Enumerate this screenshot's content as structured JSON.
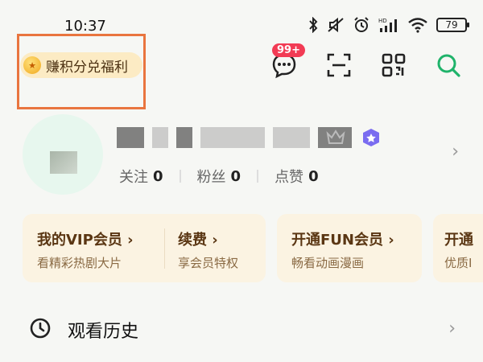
{
  "status_bar": {
    "time": "10:37",
    "battery": "79"
  },
  "earn": {
    "label": "赚积分兑福利"
  },
  "header_actions": {
    "message_badge": "99+"
  },
  "profile": {
    "stats": [
      {
        "label": "关注",
        "value": "0"
      },
      {
        "label": "粉丝",
        "value": "0"
      },
      {
        "label": "点赞",
        "value": "0"
      }
    ]
  },
  "cards": {
    "vip": {
      "title": "我的VIP会员",
      "subtitle": "看精彩热剧大片"
    },
    "renew": {
      "title": "续费",
      "subtitle": "享会员特权"
    },
    "fun": {
      "title": "开通FUN会员",
      "subtitle": "畅看动画漫画"
    },
    "more": {
      "title": "开通",
      "subtitle": "优质I"
    }
  },
  "history": {
    "label": "观看历史"
  },
  "colors": {
    "accent_green": "#1fb36a",
    "badge_red": "#f23b54",
    "highlight": "#e9753f"
  }
}
